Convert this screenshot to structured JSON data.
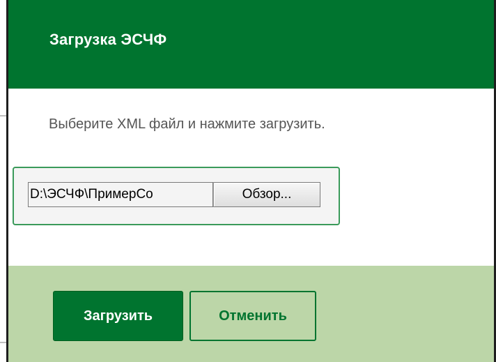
{
  "dialog": {
    "title": "Загрузка ЭСЧФ",
    "hint": "Выберите XML файл и нажмите загрузить.",
    "file_input": {
      "value": "D:\\ЭСЧФ\\ПримерСо",
      "browse_label": "Обзор..."
    },
    "buttons": {
      "upload_label": "Загрузить",
      "cancel_label": "Отменить"
    }
  },
  "colors": {
    "header_bg": "#00742f",
    "footer_bg": "#bcd6a8",
    "accent": "#00742f",
    "file_box_border": "#3a9a5a"
  }
}
